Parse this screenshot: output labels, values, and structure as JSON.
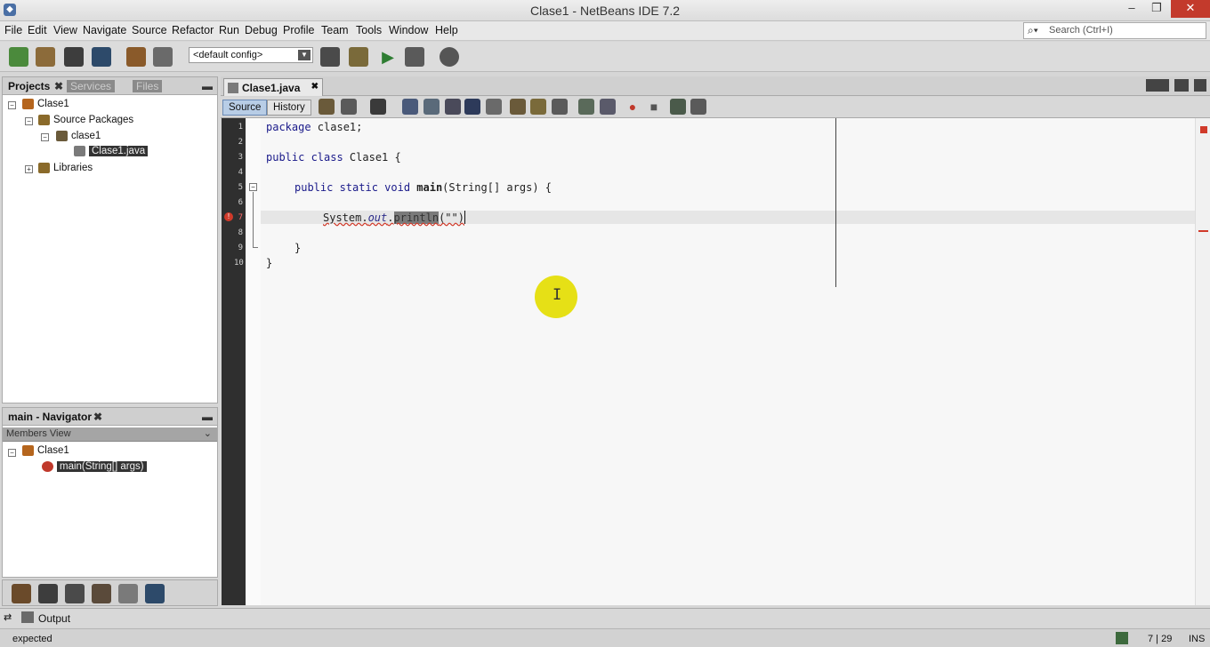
{
  "window": {
    "title": "Clase1 - NetBeans IDE 7.2",
    "min": "–",
    "max": "❐",
    "close": "✕"
  },
  "menu": [
    "File",
    "Edit",
    "View",
    "Navigate",
    "Source",
    "Refactor",
    "Run",
    "Debug",
    "Profile",
    "Team",
    "Tools",
    "Window",
    "Help"
  ],
  "search": {
    "placeholder": "Search (Ctrl+I)"
  },
  "toolbar": {
    "config": "<default config>"
  },
  "projects_panel": {
    "tabs": [
      "Projects",
      "Services",
      "Files"
    ],
    "tree": {
      "project": "Clase1",
      "source_packages": "Source Packages",
      "package": "clase1",
      "file": "Clase1.java",
      "libraries": "Libraries"
    }
  },
  "navigator": {
    "title": "main - Navigator",
    "view": "Members View",
    "class": "Clase1",
    "method": "main(String[] args)"
  },
  "editor": {
    "file_tab": "Clase1.java",
    "source_tab": "Source",
    "history_tab": "History",
    "line_numbers": [
      "1",
      "2",
      "3",
      "4",
      "5",
      "6",
      "7",
      "8",
      "9",
      "10"
    ],
    "code": {
      "l1_kw": "package",
      "l1_rest": " clase1;",
      "l3_kw": "public class",
      "l3_rest": " Clase1 {",
      "l5_kw": "public static void",
      "l5_name": " main",
      "l5_rest": "(String[] args) {",
      "l7_a": "System.",
      "l7_b": "out",
      "l7_c": ".",
      "l7_d": "println",
      "l7_e": "(\"\")",
      "l9": "}",
      "l10": "}"
    },
    "cursor_glyph": "I"
  },
  "output": {
    "label": "Output"
  },
  "status": {
    "message": "expected",
    "position": "7 | 29",
    "mode": "INS"
  }
}
